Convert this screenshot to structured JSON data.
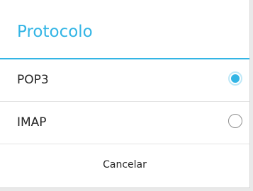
{
  "dialog": {
    "title": "Protocolo",
    "options": [
      {
        "label": "POP3",
        "selected": true
      },
      {
        "label": "IMAP",
        "selected": false
      }
    ],
    "cancel_label": "Cancelar"
  },
  "colors": {
    "accent": "#33b5e5",
    "text": "#262626",
    "background": "#ffffff"
  }
}
